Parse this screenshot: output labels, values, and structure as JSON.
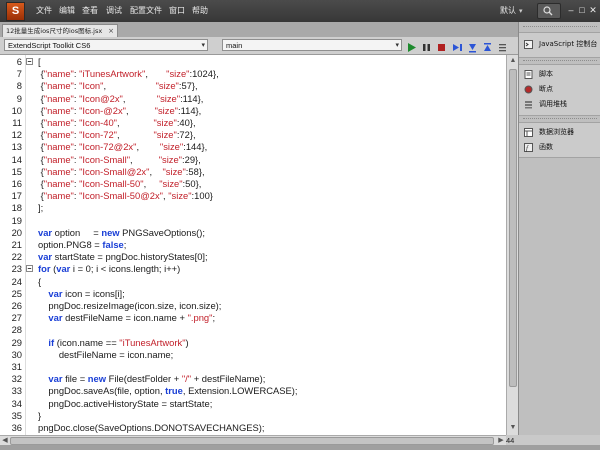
{
  "app": {
    "logo_glyph": "S"
  },
  "menu": [
    "文件",
    "编辑",
    "查看",
    "调试",
    "配置文件",
    "窗口",
    "帮助"
  ],
  "workspace": {
    "label": "默认"
  },
  "document_tab": {
    "title": "12批量生成ios尺寸的ios图标.jsx"
  },
  "toolbar": {
    "target": "ExtendScript Toolkit CS6",
    "engine": "main"
  },
  "colors": {
    "keyword": "#1a3fd6",
    "string": "#c2202a",
    "run": "#1e8a2e",
    "debug": "#2c55d6"
  },
  "code_lines": [
    {
      "num": "6",
      "html": "["
    },
    {
      "num": "7",
      "html": " {<span class=\"str\">\"name\"</span>: <span class=\"str\">\"iTunesArtwork\"</span>,       <span class=\"str\">\"size\"</span>:1024},"
    },
    {
      "num": "8",
      "html": " {<span class=\"str\">\"name\"</span>: <span class=\"str\">\"Icon\"</span>,                   <span class=\"str\">\"size\"</span>:57},"
    },
    {
      "num": "9",
      "html": " {<span class=\"str\">\"name\"</span>: <span class=\"str\">\"Icon@2x\"</span>,            <span class=\"str\">\"size\"</span>:114},"
    },
    {
      "num": "10",
      "html": " {<span class=\"str\">\"name\"</span>: <span class=\"str\">\"Icon-@2x\"</span>,          <span class=\"str\">\"size\"</span>:114},"
    },
    {
      "num": "11",
      "html": " {<span class=\"str\">\"name\"</span>: <span class=\"str\">\"Icon-40\"</span>,             <span class=\"str\">\"size\"</span>:40},"
    },
    {
      "num": "12",
      "html": " {<span class=\"str\">\"name\"</span>: <span class=\"str\">\"Icon-72\"</span>,             <span class=\"str\">\"size\"</span>:72},"
    },
    {
      "num": "13",
      "html": " {<span class=\"str\">\"name\"</span>: <span class=\"str\">\"Icon-72@2x\"</span>,        <span class=\"str\">\"size\"</span>:144},"
    },
    {
      "num": "14",
      "html": " {<span class=\"str\">\"name\"</span>: <span class=\"str\">\"Icon-Small\"</span>,          <span class=\"str\">\"size\"</span>:29},"
    },
    {
      "num": "15",
      "html": " {<span class=\"str\">\"name\"</span>: <span class=\"str\">\"Icon-Small@2x\"</span>,    <span class=\"str\">\"size\"</span>:58},"
    },
    {
      "num": "16",
      "html": " {<span class=\"str\">\"name\"</span>: <span class=\"str\">\"Icon-Small-50\"</span>,     <span class=\"str\">\"size\"</span>:50},"
    },
    {
      "num": "17",
      "html": " {<span class=\"str\">\"name\"</span>: <span class=\"str\">\"Icon-Small-50@2x\"</span>, <span class=\"str\">\"size\"</span>:100}"
    },
    {
      "num": "18",
      "html": "];"
    },
    {
      "num": "19",
      "html": ""
    },
    {
      "num": "20",
      "html": "<span class=\"kw\">var</span> option     = <span class=\"kw\">new</span> PNGSaveOptions();"
    },
    {
      "num": "21",
      "html": "option.PNG8 = <span class=\"kw\">false</span>;"
    },
    {
      "num": "22",
      "html": "<span class=\"kw\">var</span> startState = pngDoc.historyStates[0];"
    },
    {
      "num": "23",
      "html": "<span class=\"kw\">for</span> (<span class=\"kw\">var</span> i = 0; i &lt; icons.length; i++)"
    },
    {
      "num": "24",
      "html": "{"
    },
    {
      "num": "25",
      "html": "    <span class=\"kw\">var</span> icon = icons[i];"
    },
    {
      "num": "26",
      "html": "    pngDoc.resizeImage(icon.size, icon.size);"
    },
    {
      "num": "27",
      "html": "    <span class=\"kw\">var</span> destFileName = icon.name + <span class=\"str\">\".png\"</span>;"
    },
    {
      "num": "28",
      "html": ""
    },
    {
      "num": "29",
      "html": "    <span class=\"kw\">if</span> (icon.name == <span class=\"str\">\"iTunesArtwork\"</span>)"
    },
    {
      "num": "30",
      "html": "        destFileName = icon.name;"
    },
    {
      "num": "31",
      "html": ""
    },
    {
      "num": "32",
      "html": "    <span class=\"kw\">var</span> file = <span class=\"kw\">new</span> File(destFolder + <span class=\"str\">\"/\"</span> + destFileName);"
    },
    {
      "num": "33",
      "html": "    pngDoc.saveAs(file, option, <span class=\"kw\">true</span>, Extension.LOWERCASE);"
    },
    {
      "num": "34",
      "html": "    pngDoc.activeHistoryState = startState;"
    },
    {
      "num": "35",
      "html": "}"
    },
    {
      "num": "36",
      "html": "pngDoc.close(SaveOptions.DONOTSAVECHANGES);"
    }
  ],
  "status": {
    "line_count": "44"
  },
  "panel": {
    "header": "JavaScript 控制台",
    "items": [
      "脚本",
      "断点",
      "调用堆栈"
    ],
    "items2": [
      "数据浏览器",
      "函数"
    ]
  }
}
